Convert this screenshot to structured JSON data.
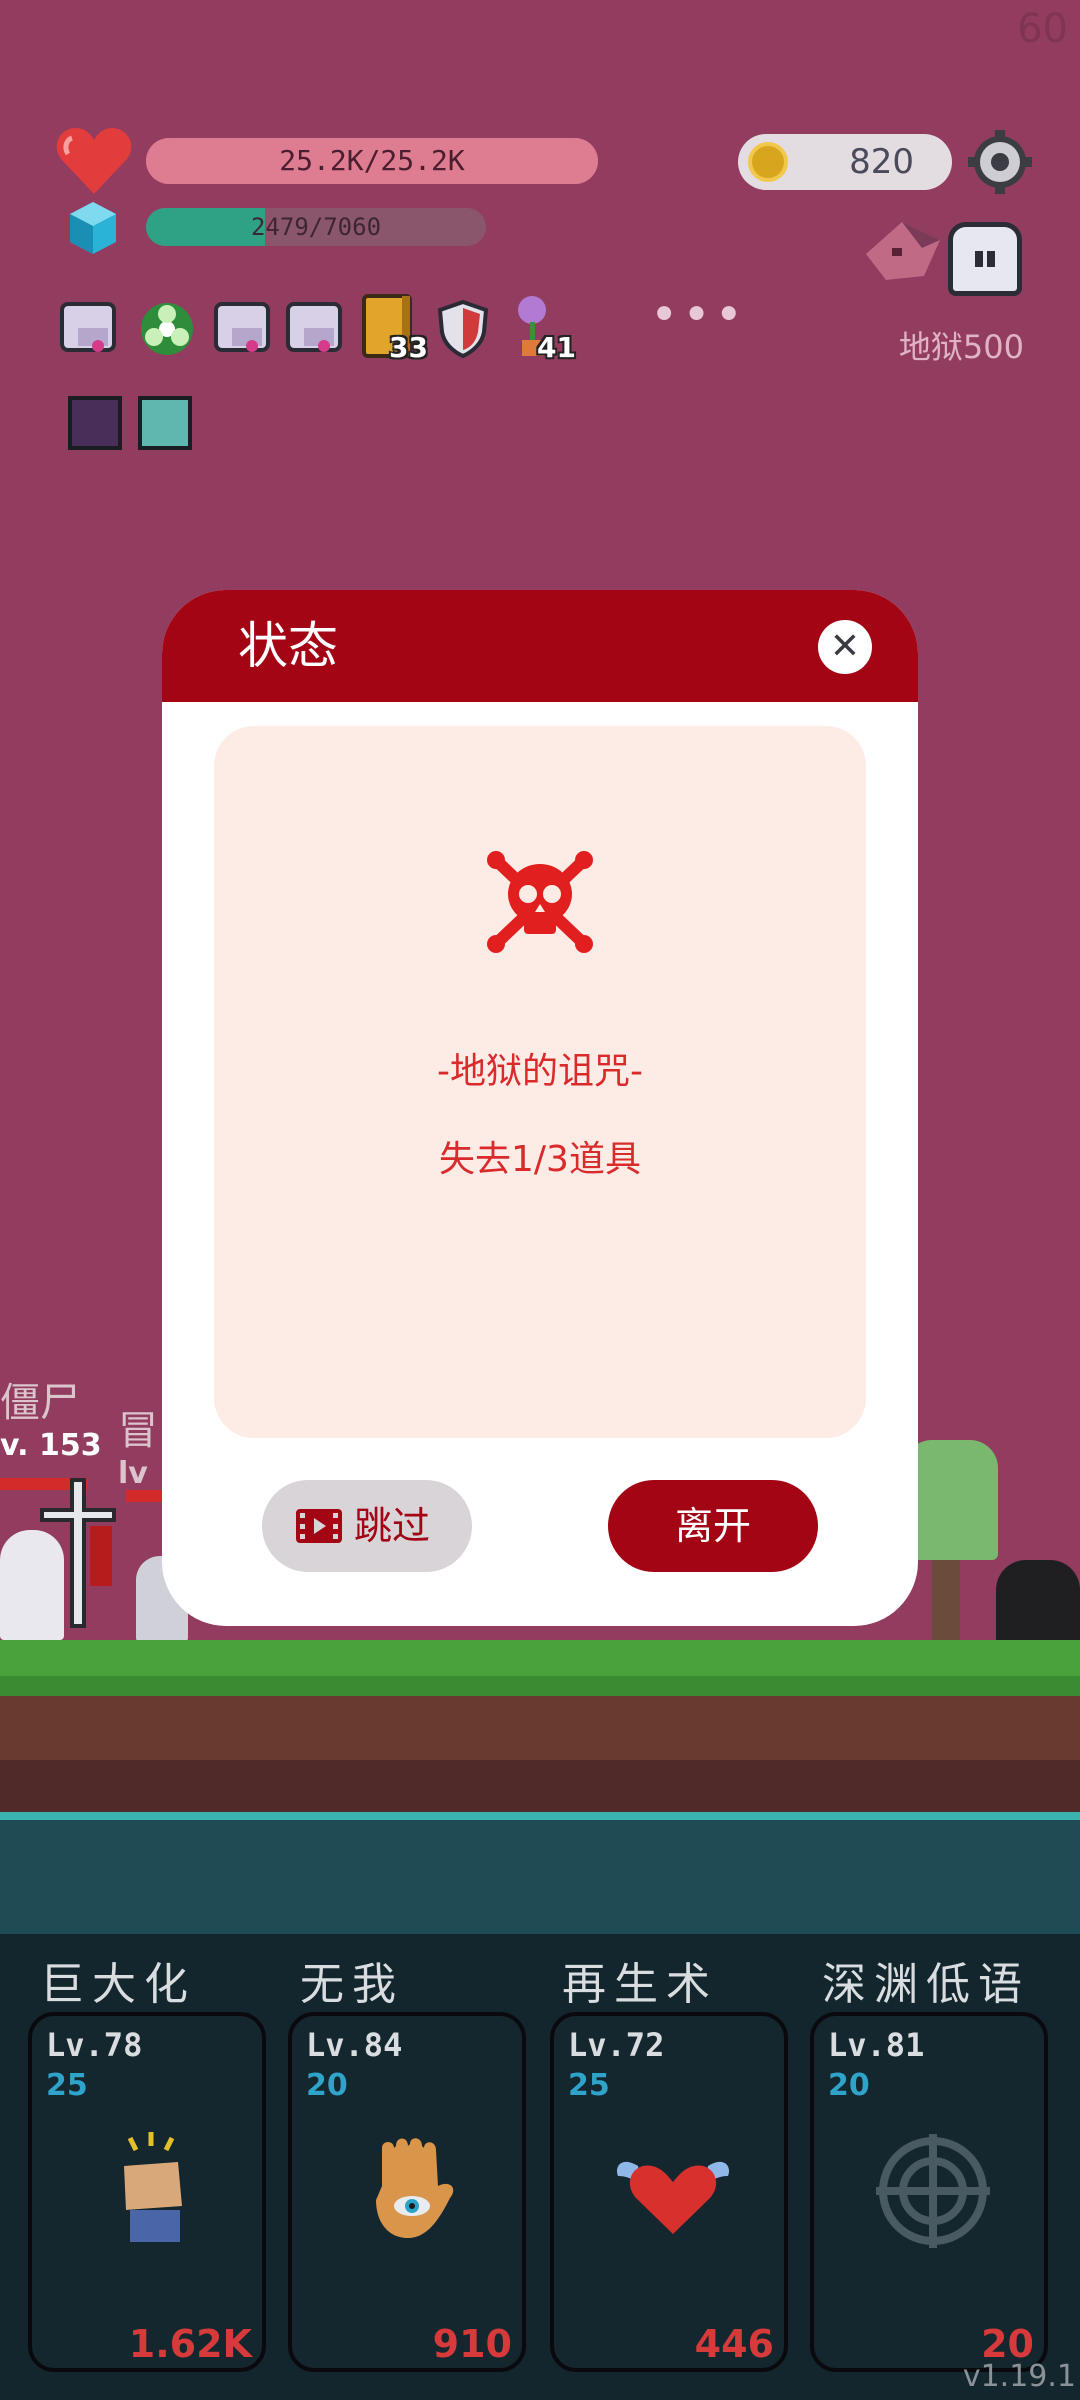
{
  "status": {
    "fps": "60"
  },
  "player": {
    "hp_text": "25.2K/25.2K",
    "hp_fraction": 1.0,
    "xp_text": "2479/7060",
    "xp_fraction": 0.351,
    "coins": "820",
    "stage_label": "地狱500"
  },
  "items": [
    {
      "icon": "ribbon-scroll-icon"
    },
    {
      "icon": "biohazard-icon"
    },
    {
      "icon": "ribbon-scroll-icon"
    },
    {
      "icon": "ribbon-scroll-icon"
    },
    {
      "icon": "book-icon",
      "count": "33"
    },
    {
      "icon": "shield-icon"
    },
    {
      "icon": "flower-icon",
      "count": "41"
    }
  ],
  "enemies": [
    {
      "name": "僵尸",
      "level": "v. 153"
    },
    {
      "name": "冒",
      "level": "lv"
    }
  ],
  "modal": {
    "title": "状态",
    "close_icon": "close-icon",
    "curse_icon": "skull-crossbones-icon",
    "curse_title": "-地狱的诅咒-",
    "curse_desc": "失去1/3道具",
    "skip_label": "跳过",
    "leave_label": "离开"
  },
  "skills": [
    {
      "name": "巨大化",
      "level": "Lv.78",
      "cost": "25",
      "value": "1.62K",
      "icon": "fist-icon"
    },
    {
      "name": "无我",
      "level": "Lv.84",
      "cost": "20",
      "value": "910",
      "icon": "hamsa-eye-icon"
    },
    {
      "name": "再生术",
      "level": "Lv.72",
      "cost": "25",
      "value": "446",
      "icon": "winged-heart-icon"
    },
    {
      "name": "深渊低语",
      "level": "Lv.81",
      "cost": "20",
      "value": "20",
      "icon": "crosshair-icon"
    }
  ],
  "version": "v1.19.1",
  "colors": {
    "modal_red": "#a30515",
    "background": "#923c5f",
    "curse_text": "#d92b2b"
  }
}
